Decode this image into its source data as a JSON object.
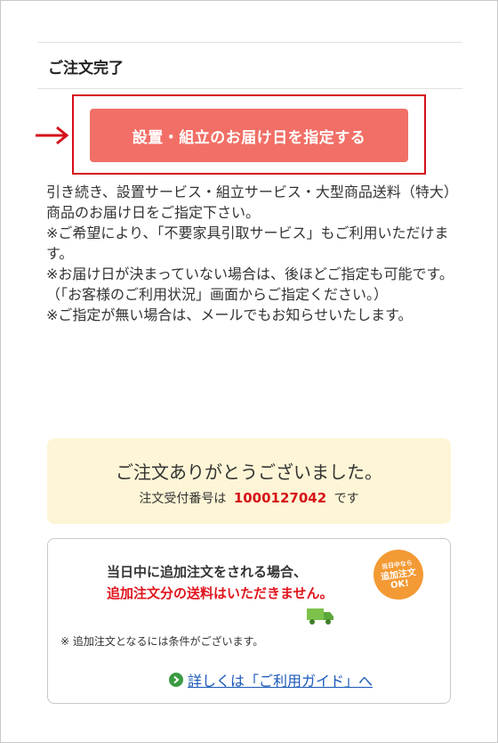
{
  "header": {
    "title": "ご注文完了"
  },
  "primary_button": {
    "label": "設置・組立のお届け日を指定する"
  },
  "notice": {
    "lines": [
      "引き続き、設置サービス・組立サービス・大型商品送料（特大）商品のお届け日をご指定下さい。",
      "※ご希望により、「不要家具引取サービス」もご利用いただけます。",
      "※お届け日が決まっていない場合は、後ほどご指定も可能です。",
      "（「お客様のご利用状況」画面からご指定ください。）",
      "※ご指定が無い場合は、メールでもお知らせいたします。"
    ]
  },
  "thanks": {
    "message": "ご注文ありがとうございました。",
    "order_label": "注文受付番号は",
    "order_number": "1000127042",
    "order_suffix": "です"
  },
  "promo": {
    "line1": "当日中に追加注文をされる場合、",
    "line2": "追加注文分の送料はいただきません。",
    "badge_top": "当日中なら",
    "badge_main": "追加注文",
    "badge_ok": "OK!",
    "condition_note": "※ 追加注文となるには条件がございます。",
    "guide_link": "詳しくは「ご利用ガイド」へ"
  },
  "colors": {
    "button": "#f16f66",
    "highlight_border": "#d6101b",
    "order_number": "#d61318",
    "thanks_bg": "#fdf5d6",
    "link": "#1a58b8",
    "badge": "#f39a35"
  }
}
